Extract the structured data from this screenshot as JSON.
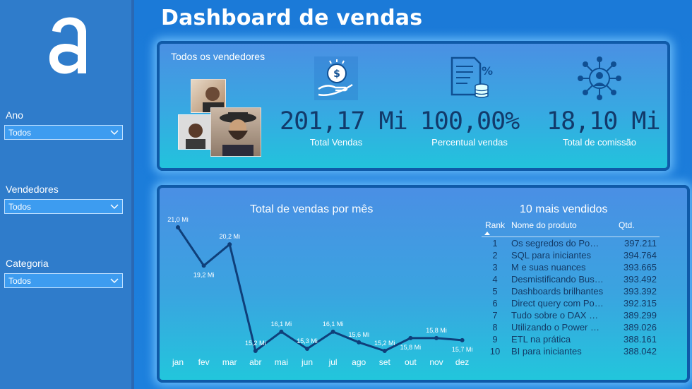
{
  "header": {
    "title": "Dashboard de vendas"
  },
  "sidebar": {
    "logo_text": "a",
    "filters": [
      {
        "label": "Ano",
        "value": "Todos"
      },
      {
        "label": "Vendedores",
        "value": "Todos"
      },
      {
        "label": "Categoria",
        "value": "Todos"
      }
    ]
  },
  "top_panel": {
    "vendors_label": "Todos os vendedores",
    "kpis": [
      {
        "value": "201,17 Mi",
        "label": "Total Vendas",
        "icon": "money-hand-icon"
      },
      {
        "value": "100,00%",
        "label": "Percentual vendas",
        "icon": "percent-document-icon"
      },
      {
        "value": "18,10 Mi",
        "label": "Total de comissão",
        "icon": "commission-network-icon"
      }
    ]
  },
  "chart_data": {
    "type": "line",
    "title": "Total de vendas por mês",
    "categories": [
      "jan",
      "fev",
      "mar",
      "abr",
      "mai",
      "jun",
      "jul",
      "ago",
      "set",
      "out",
      "nov",
      "dez"
    ],
    "values": [
      21.0,
      19.2,
      20.2,
      15.2,
      16.1,
      15.3,
      16.1,
      15.6,
      15.2,
      15.8,
      15.8,
      15.7
    ],
    "data_labels": [
      "21,0 Mi",
      "19,2 Mi",
      "20,2 Mi",
      "15,2 Mi",
      "16,1 Mi",
      "15,3 Mi",
      "16,1 Mi",
      "15,6 Mi",
      "15,2 Mi",
      "15,8 Mi",
      "15,8 Mi",
      "15,7 Mi"
    ],
    "ylim": [
      15.2,
      21.0
    ],
    "xlabel": "",
    "ylabel": "",
    "series_color": "#0f3f7a",
    "grid": false
  },
  "top_products": {
    "title": "10 mais vendidos",
    "columns": [
      "Rank",
      "Nome do produto",
      "Qtd."
    ],
    "rows": [
      {
        "rank": "1",
        "name": "Os segredos do Po…",
        "qtd": "397.211"
      },
      {
        "rank": "2",
        "name": "SQL para iniciantes",
        "qtd": "394.764"
      },
      {
        "rank": "3",
        "name": "M e suas nuances",
        "qtd": "393.665"
      },
      {
        "rank": "4",
        "name": "Desmistificando Bus…",
        "qtd": "393.492"
      },
      {
        "rank": "5",
        "name": "Dashboards brilhantes",
        "qtd": "393.392"
      },
      {
        "rank": "6",
        "name": "Direct query com Po…",
        "qtd": "392.315"
      },
      {
        "rank": "7",
        "name": "Tudo sobre o DAX …",
        "qtd": "389.299"
      },
      {
        "rank": "8",
        "name": "Utilizando o Power …",
        "qtd": "389.026"
      },
      {
        "rank": "9",
        "name": "ETL na prática",
        "qtd": "388.161"
      },
      {
        "rank": "10",
        "name": "BI para iniciantes",
        "qtd": "388.042"
      }
    ]
  },
  "colors": {
    "background": "#1b7ad8",
    "sidebar": "#2f7ccb",
    "kpi_value": "#123a6b",
    "table_text": "#133a66"
  }
}
